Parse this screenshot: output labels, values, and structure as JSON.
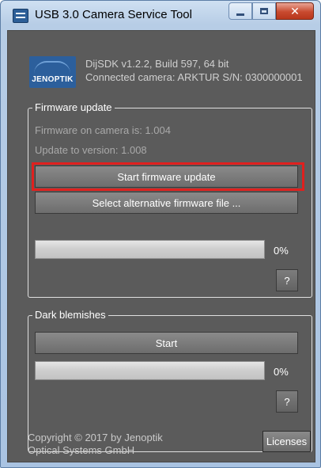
{
  "window": {
    "title": "USB 3.0 Camera Service Tool",
    "minimize_icon": "minimize-icon",
    "maximize_icon": "maximize-icon",
    "close_icon": "close-icon"
  },
  "header": {
    "logo_text": "JENOPTIK",
    "sdk_info": "DijSDK v1.2.2, Build 597, 64 bit",
    "camera_info": "Connected camera: ARKTUR S/N: 0300000001"
  },
  "firmware": {
    "legend": "Firmware update",
    "current": "Firmware on camera is: 1.004",
    "target": "Update to version: 1.008",
    "start_label": "Start firmware update",
    "select_label": "Select alternative firmware file ...",
    "progress_percent": 0,
    "progress_text": "0%",
    "help_label": "?"
  },
  "dark_blemishes": {
    "legend": "Dark blemishes",
    "start_label": "Start",
    "progress_percent": 0,
    "progress_text": "0%",
    "help_label": "?"
  },
  "footer": {
    "copyright_line1": "Copyright © 2017 by Jenoptik",
    "copyright_line2": "Optical Systems GmbH",
    "licenses_label": "Licenses"
  },
  "colors": {
    "client_bg": "#5b5b5b",
    "highlight": "#e0201e",
    "logo_blue": "#2c5f9c"
  }
}
